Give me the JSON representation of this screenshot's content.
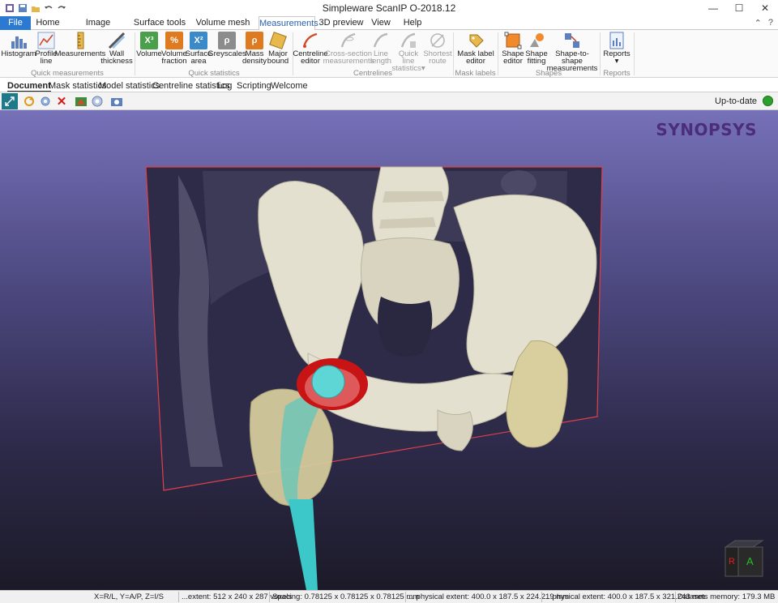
{
  "window": {
    "title": "Simpleware ScanIP O-2018.12",
    "minimize": "—",
    "maximize": "☐",
    "close": "✕"
  },
  "tabs": [
    "File",
    "Home",
    "Image processing",
    "Surface tools",
    "Volume mesh tools",
    "Measurements",
    "3D preview",
    "View",
    "Help"
  ],
  "ribbon": {
    "quick_measurements": {
      "label": "Quick measurements",
      "buttons": [
        "Histogram",
        "Profile\nline",
        "Measurements",
        "Wall\nthickness"
      ]
    },
    "quick_statistics": {
      "label": "Quick statistics",
      "buttons": [
        "Volume",
        "Volume\nfraction",
        "Surface\narea",
        "Greyscales",
        "Mass\ndensity",
        "Major\nbound"
      ]
    },
    "centrelines": {
      "label": "Centrelines",
      "buttons": [
        "Centreline\neditor",
        "Cross-section\nmeasurements",
        "Line\nlength",
        "Quick line\nstatistics▾",
        "Shortest\nroute"
      ]
    },
    "mask_labels": {
      "label": "Mask labels",
      "buttons": [
        "Mask label\neditor"
      ]
    },
    "shapes": {
      "label": "Shapes",
      "buttons": [
        "Shape\neditor",
        "Shape\nfitting",
        "Shape-to-shape\nmeasurements"
      ]
    },
    "reports": {
      "label": "Reports",
      "buttons": [
        "Reports\n▾"
      ]
    }
  },
  "doc_tabs": [
    "Document",
    "Mask statistics",
    "Model statistics",
    "Centreline statistics",
    "Log",
    "Scripting",
    "Welcome"
  ],
  "toolbar": {
    "status": "Up-to-date"
  },
  "viewport": {
    "logo": "SYNOPSYS",
    "orientation": {
      "left": "R",
      "front": "A"
    }
  },
  "statusbar": {
    "axes": "X=R/L, Y=A/P, Z=I/S",
    "extent": "...extent: 512 x 240 x 287 voxels",
    "spacing": "Spacing: 0.78125 x 0.78125 x 0.78125 mm",
    "physical1": "... physical extent: 400.0 x 187.5 x 224.219 mm",
    "physical2": "... physical extent: 400.0 x 187.5 x 321.243 mm",
    "memory": "Datasets memory: 179.3 MB"
  },
  "colors": {
    "accent": "#2b79d0",
    "status_ok": "#2ca02c",
    "implant_red": "#d01818",
    "implant_cyan": "#3cc8c8",
    "bone": "#e3e0cf"
  }
}
